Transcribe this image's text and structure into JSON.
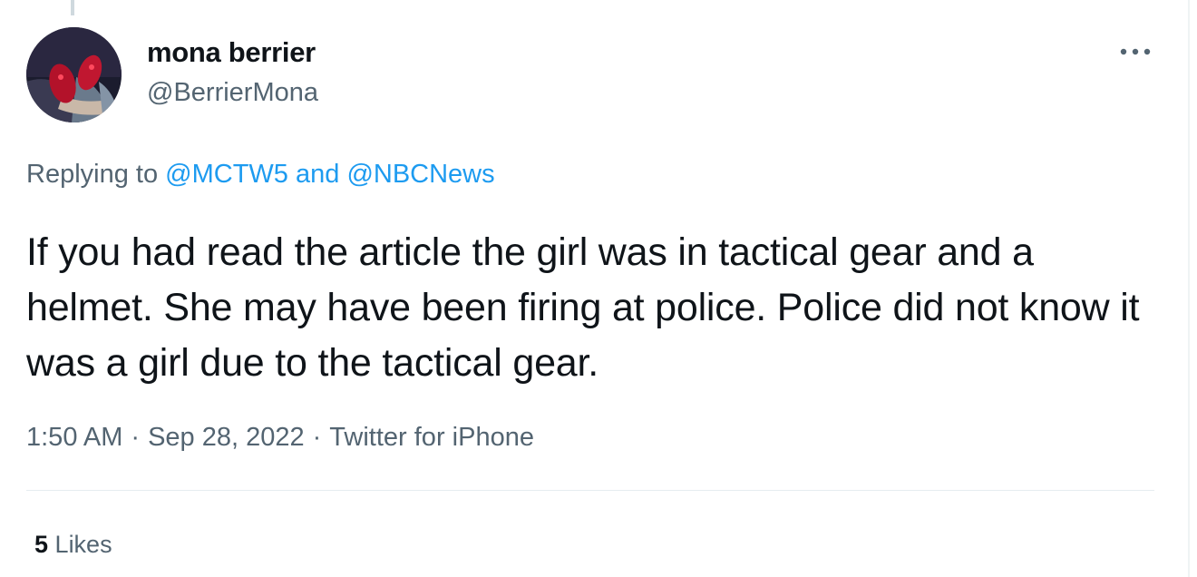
{
  "tweet": {
    "display_name": "mona berrier",
    "handle": "@BerrierMona",
    "more_icon": "more-horizontal-icon",
    "replying_prefix": "Replying to",
    "reply_mentions": [
      "@MCTW5",
      "@NBCNews"
    ],
    "reply_and": "and",
    "text": "If you had read the article the girl was in tactical gear and a helmet. She may have been firing at police. Police did not know it was a girl due to the tactical gear.",
    "time": "1:50 AM",
    "separator": "·",
    "date": "Sep 28, 2022",
    "source": "Twitter for iPhone",
    "likes_count": "5",
    "likes_label": "Likes"
  },
  "colors": {
    "text_primary": "#0f1419",
    "text_secondary": "#536471",
    "link": "#1d9bf0",
    "divider": "#e6ecf0"
  }
}
